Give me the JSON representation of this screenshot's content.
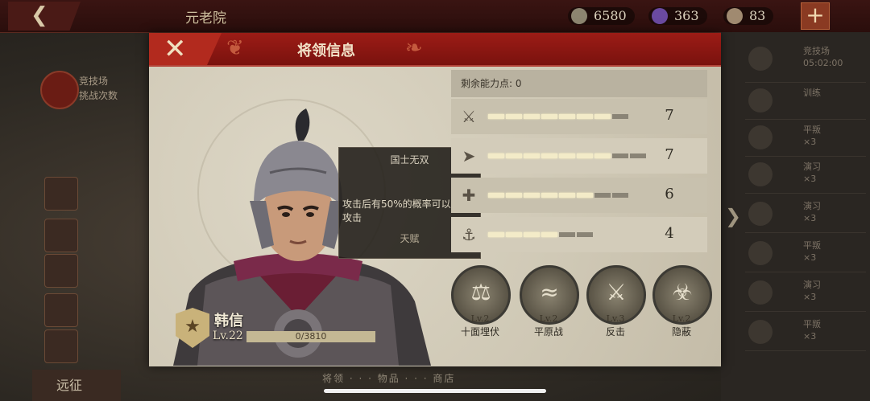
{
  "topbar": {
    "back_icon": "chevron-left-icon",
    "title": "元老院",
    "resources": [
      {
        "icon": "coin-icon",
        "value": "6580",
        "color": "#8c8570"
      },
      {
        "icon": "gem-icon",
        "value": "363",
        "color": "#6a4aa0"
      },
      {
        "icon": "food-icon",
        "value": "83",
        "color": "#a08a70"
      }
    ],
    "plus_label": "+"
  },
  "left_panel": {
    "arena_title": "竞技场",
    "arena_sub": "挑战次数",
    "bottom_label": "远征"
  },
  "right_panel": {
    "arena_title": "竞技场",
    "arena_time": "05:02:00",
    "rows": [
      {
        "title": "训练",
        "count": ""
      },
      {
        "title": "平叛",
        "count": "×3"
      },
      {
        "title": "演习",
        "count": "×3"
      },
      {
        "title": "演习",
        "count": "×3"
      },
      {
        "title": "平叛",
        "count": "×3"
      },
      {
        "title": "演习",
        "count": "×3"
      },
      {
        "title": "平叛",
        "count": "×3"
      }
    ]
  },
  "dialog": {
    "title": "将领信息",
    "close_icon": "close-icon",
    "tooltip": {
      "title": "国士无双",
      "description": "攻击后有50%的概率可以再次攻击",
      "talent_label": "天赋"
    },
    "general": {
      "name": "韩信",
      "level": "Lv.22",
      "exp": "0/3810"
    },
    "points_label": "剩余能力点: 0",
    "stats": [
      {
        "icon": "sword-icon",
        "value": "7",
        "filled": 7,
        "total": 8
      },
      {
        "icon": "bow-icon",
        "value": "7",
        "filled": 7,
        "total": 9
      },
      {
        "icon": "axe-icon",
        "value": "6",
        "filled": 6,
        "total": 8
      },
      {
        "icon": "anchor-icon",
        "value": "4",
        "filled": 4,
        "total": 6
      }
    ],
    "skills": [
      {
        "level": "Lv.2",
        "name": "十面埋伏",
        "icon": "ambush-icon"
      },
      {
        "level": "Lv.2",
        "name": "平原战",
        "icon": "plains-icon"
      },
      {
        "level": "Lv.3",
        "name": "反击",
        "icon": "counter-icon"
      },
      {
        "level": "Lv.2",
        "name": "隐蔽",
        "icon": "stealth-icon"
      }
    ]
  },
  "footer_tabs": "将领 · · · 物品 · · · 商店"
}
